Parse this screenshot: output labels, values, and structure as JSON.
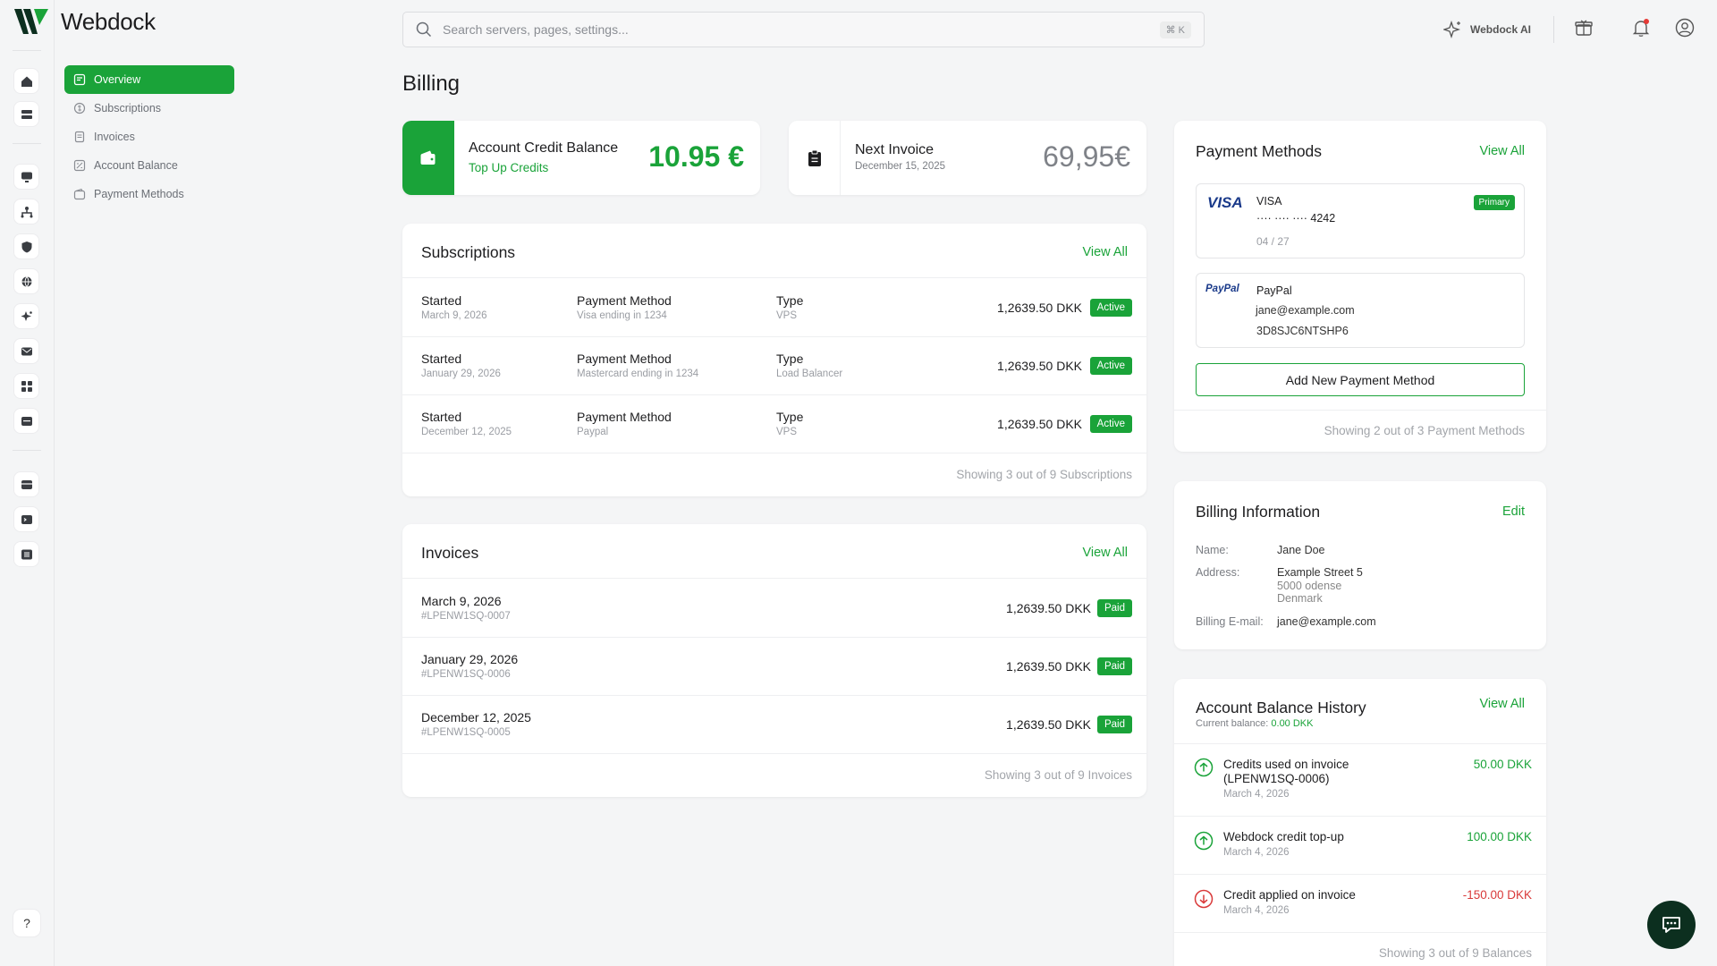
{
  "app": {
    "name": "Webdock"
  },
  "search": {
    "placeholder": "Search servers, pages, settings...",
    "shortcut": "⌘ K"
  },
  "topbar": {
    "ai_label": "Webdock AI"
  },
  "subnav": {
    "items": [
      {
        "label": "Overview",
        "icon": "overview-icon",
        "active": true
      },
      {
        "label": "Subscriptions",
        "icon": "subscriptions-icon",
        "active": false
      },
      {
        "label": "Invoices",
        "icon": "invoices-icon",
        "active": false
      },
      {
        "label": "Account Balance",
        "icon": "balance-icon",
        "active": false
      },
      {
        "label": "Payment Methods",
        "icon": "wallet-icon",
        "active": false
      }
    ]
  },
  "rail": {
    "help": "?"
  },
  "page": {
    "title": "Billing"
  },
  "credit": {
    "title": "Account Credit Balance",
    "link": "Top Up Credits",
    "amount": "10.95 €"
  },
  "next_invoice": {
    "title": "Next Invoice",
    "date": "December 15, 2025",
    "amount": "69,95€"
  },
  "subscriptions": {
    "title": "Subscriptions",
    "view_all": "View All",
    "rows": [
      {
        "started_label": "Started",
        "started": "March 9, 2026",
        "pm_label": "Payment Method",
        "pm": "Visa ending in 1234",
        "type_label": "Type",
        "type": "VPS",
        "amount": "1,2639.50 DKK",
        "status": "Active"
      },
      {
        "started_label": "Started",
        "started": "January 29, 2026",
        "pm_label": "Payment Method",
        "pm": "Mastercard ending in 1234",
        "type_label": "Type",
        "type": "Load Balancer",
        "amount": "1,2639.50 DKK",
        "status": "Active"
      },
      {
        "started_label": "Started",
        "started": "December 12, 2025",
        "pm_label": "Payment Method",
        "pm": "Paypal",
        "type_label": "Type",
        "type": "VPS",
        "amount": "1,2639.50 DKK",
        "status": "Active"
      }
    ],
    "footer": "Showing 3 out of 9 Subscriptions"
  },
  "invoices": {
    "title": "Invoices",
    "view_all": "View All",
    "rows": [
      {
        "date": "March 9, 2026",
        "id": "#LPENW1SQ-0007",
        "amount": "1,2639.50 DKK",
        "status": "Paid"
      },
      {
        "date": "January 29, 2026",
        "id": "#LPENW1SQ-0006",
        "amount": "1,2639.50 DKK",
        "status": "Paid"
      },
      {
        "date": "December 12, 2025",
        "id": "#LPENW1SQ-0005",
        "amount": "1,2639.50 DKK",
        "status": "Paid"
      }
    ],
    "footer": "Showing 3 out of 9 Invoices"
  },
  "payment_methods": {
    "title": "Payment Methods",
    "view_all": "View All",
    "visa": {
      "logo": "VISA",
      "name": "VISA",
      "masked": "···· ···· ····",
      "last4": "4242",
      "expiry": "04 / 27",
      "badge": "Primary"
    },
    "paypal": {
      "logo": "PayPal",
      "name": "PayPal",
      "email": "jane@example.com",
      "id": "3D8SJC6NTSHP6"
    },
    "add_button": "Add New Payment Method",
    "footer": "Showing 2 out of 3 Payment Methods"
  },
  "billing_info": {
    "title": "Billing Information",
    "edit": "Edit",
    "name_label": "Name:",
    "name": "Jane Doe",
    "address_label": "Address:",
    "address1": "Example Street 5",
    "address2": "5000 odense",
    "address3": "Denmark",
    "email_label": "Billing E-mail:",
    "email": "jane@example.com"
  },
  "balance_history": {
    "title": "Account Balance History",
    "view_all": "View All",
    "current_label": "Current balance:",
    "current": "0.00 DKK",
    "rows": [
      {
        "title1": "Credits used on invoice",
        "title2": "(LPENW1SQ-0006)",
        "date": "March 4, 2026",
        "amount": "50.00 DKK",
        "direction": "up"
      },
      {
        "title1": "Webdock credit top-up",
        "date": "March 4, 2026",
        "amount": "100.00 DKK",
        "direction": "up"
      },
      {
        "title1": "Credit applied on invoice",
        "date": "March 4, 2026",
        "amount": "-150.00 DKK",
        "direction": "down"
      }
    ],
    "footer": "Showing 3 out of 9 Balances"
  },
  "colors": {
    "accent": "#1aa339",
    "negative": "#d93a3a",
    "chat": "#0c2f1f"
  }
}
